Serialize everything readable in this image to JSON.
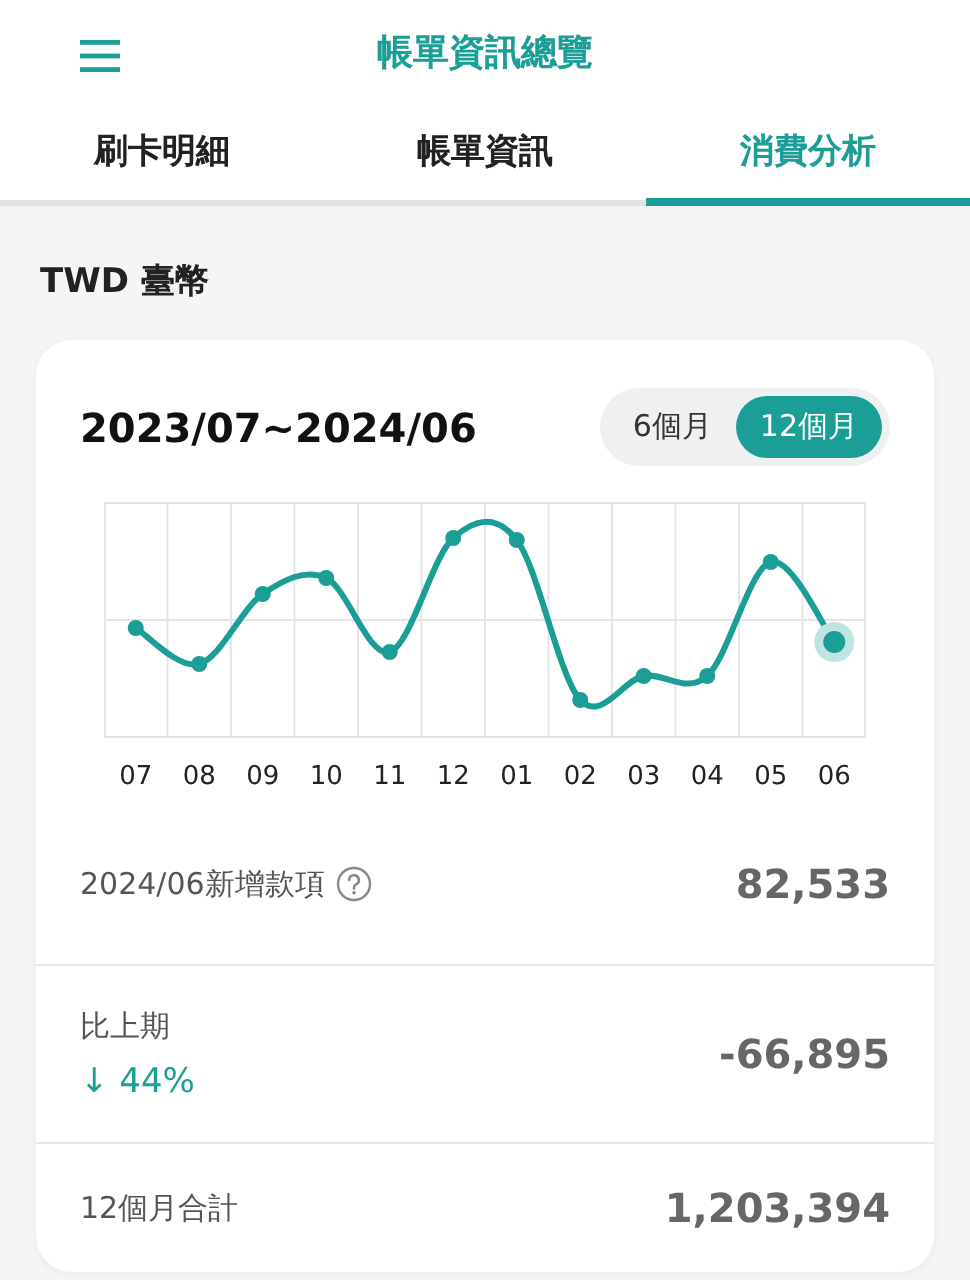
{
  "header": {
    "title": "帳單資訊總覽"
  },
  "tabs": [
    {
      "label": "刷卡明細",
      "selected": false
    },
    {
      "label": "帳單資訊",
      "selected": false
    },
    {
      "label": "消費分析",
      "selected": true
    }
  ],
  "currency": "TWD 臺幣",
  "card": {
    "period": "2023/07~2024/06",
    "range_options": [
      {
        "label": "6個月",
        "selected": false
      },
      {
        "label": "12個月",
        "selected": true
      }
    ],
    "x_labels": [
      "07",
      "08",
      "09",
      "10",
      "11",
      "12",
      "01",
      "02",
      "03",
      "04",
      "05",
      "06"
    ],
    "rows": [
      {
        "label": "2024/06新增款項",
        "help": true,
        "value": "82,533"
      },
      {
        "label": "比上期",
        "change": "↓ 44%",
        "value": "-66,895"
      },
      {
        "label": "12個月合計",
        "value": "1,203,394"
      }
    ]
  }
}
